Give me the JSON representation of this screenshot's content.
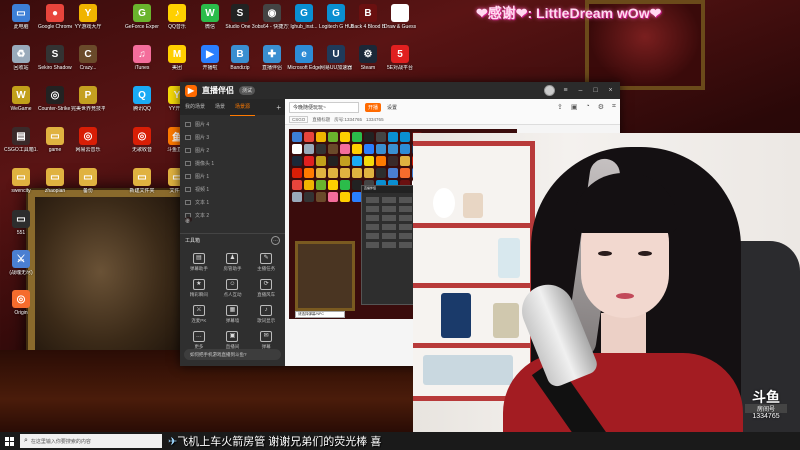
{
  "banner": {
    "text": "❤感谢❤: LittleDream wOw❤"
  },
  "desktop_icons": [
    {
      "label": "此电脑",
      "color": "#3d7fd6",
      "glyph": "▭"
    },
    {
      "label": "Google Chrome",
      "color": "#e8453c",
      "glyph": "●"
    },
    {
      "label": "YY游戏大厅",
      "color": "#f0b400",
      "glyph": "Y"
    },
    {
      "label": "GeForce Experience",
      "color": "#6ab42d",
      "glyph": "G"
    },
    {
      "label": "QQ音乐",
      "color": "#ffd000",
      "glyph": "♪"
    },
    {
      "label": "微信",
      "color": "#2bbc4a",
      "glyph": "W"
    },
    {
      "label": "Studio One 3",
      "color": "#222",
      "glyph": "S"
    },
    {
      "label": "obs64 - 快捷方式",
      "color": "#444",
      "glyph": "◉"
    },
    {
      "label": "lghub_inst...",
      "color": "#0a8fd1",
      "glyph": "G"
    },
    {
      "label": "Logitech G HUB",
      "color": "#0a8fd1",
      "glyph": "G"
    },
    {
      "label": "Back 4 Blood Beta",
      "color": "#6a1010",
      "glyph": "B"
    },
    {
      "label": "Draw & Guess",
      "color": "#ffffff",
      "glyph": "✎"
    },
    {
      "label": "回收站",
      "color": "#9ab",
      "glyph": "♻"
    },
    {
      "label": "Sekiro Shadows Die...",
      "color": "#333",
      "glyph": "S"
    },
    {
      "label": "Crazy...",
      "color": "#6a4a2a",
      "glyph": "C"
    },
    {
      "label": "iTunes",
      "color": "#f46d9b",
      "glyph": "♫"
    },
    {
      "label": "美团",
      "color": "#ffcf00",
      "glyph": "M"
    },
    {
      "label": "开播啦",
      "color": "#2a7fff",
      "glyph": "▶"
    },
    {
      "label": "Bandizip",
      "color": "#3a8fd1",
      "glyph": "B"
    },
    {
      "label": "直播伴侣",
      "color": "#3a8fd1",
      "glyph": "✚"
    },
    {
      "label": "Microsoft Edge",
      "color": "#2d8cd6",
      "glyph": "e"
    },
    {
      "label": "网易UU加速器",
      "color": "#1f3a5a",
      "glyph": "U"
    },
    {
      "label": "Steam",
      "color": "#1b2838",
      "glyph": "⚙"
    },
    {
      "label": "5E对战平台",
      "color": "#e02020",
      "glyph": "5"
    },
    {
      "label": "WeGame",
      "color": "#c2a01a",
      "glyph": "W"
    },
    {
      "label": "Counter-Strike Global Off...",
      "color": "#222",
      "glyph": "◎"
    },
    {
      "label": "完美世界竞技平台",
      "color": "#c4a020",
      "glyph": "P"
    },
    {
      "label": "腾讯QQ",
      "color": "#1aaaf5",
      "glyph": "Q"
    },
    {
      "label": "YY开播",
      "color": "#f5d90a",
      "glyph": "Y"
    },
    {
      "label": "斗鱼直播伴侣",
      "color": "#ff7a00",
      "glyph": "鱼"
    },
    {
      "label": "CSGO工具箱1.0.3 (2)",
      "color": "#3a2a2a",
      "glyph": "▤"
    },
    {
      "label": "game",
      "color": "#e0b240",
      "glyph": "▭"
    },
    {
      "label": "网易云音乐",
      "color": "#d81e06",
      "glyph": "◎"
    },
    {
      "label": "无歌收音",
      "color": "#d81e06",
      "glyph": "◎"
    },
    {
      "label": "斗鱼直播",
      "color": "#ff7a00",
      "glyph": "鱼"
    },
    {
      "label": "swencity",
      "color": "#e0b240",
      "glyph": "▭"
    },
    {
      "label": "zhaopian",
      "color": "#e0b240",
      "glyph": "▭"
    },
    {
      "label": "备份",
      "color": "#e0b240",
      "glyph": "▭"
    },
    {
      "label": "新建文件夹",
      "color": "#e0b240",
      "glyph": "▭"
    },
    {
      "label": "文件夹",
      "color": "#e0b240",
      "glyph": "▭"
    },
    {
      "label": "551",
      "color": "#2d2d2d",
      "glyph": "▭"
    },
    {
      "label": "(战魂无尽)",
      "color": "#4a7fd1",
      "glyph": "⚔"
    },
    {
      "label": "Origin",
      "color": "#f56c2d",
      "glyph": "◎"
    }
  ],
  "app": {
    "title": "直播伴侣",
    "badge": "测试",
    "tabs": [
      "我的场景",
      "场景",
      "场景源"
    ],
    "active_tab": 2,
    "scenes": [
      "图片 4",
      "图片 3",
      "图片 2",
      "摄像头 1",
      "图片 1",
      "视频 1",
      "文本 1",
      "文本 2"
    ],
    "tool_header": "工具箱",
    "tools": [
      "弹幕助手",
      "房管助手",
      "主播任务",
      "精彩瞬间",
      "点人互动",
      "直播风车",
      "连麦PK",
      "弹幕墙",
      "歌词显示",
      "更多",
      "直播间",
      "弹幕"
    ],
    "help_text": "如何把手机游戏直播到斗鱼?",
    "room_title": "今晚随便玩玩~",
    "live_tag": "开播",
    "room_settings": "设置",
    "category": "CSGO",
    "category_sub": "直播标题",
    "room_number_label": "房号:1334765",
    "room_number": "1334765",
    "cam_box": "请选择弹幕/NPC",
    "bottom_tools": [
      "直播屏幕",
      "摄像头",
      "全屏"
    ]
  },
  "overlay": {
    "logo_mark": "斗鱼",
    "room_label": "房间号",
    "room_id": "1334765"
  },
  "taskbar": {
    "search_placeholder": "在这里输入你要搜索的内容",
    "ticker": "飞机上车火箭房管 谢谢兄弟们的荧光棒 喜"
  }
}
